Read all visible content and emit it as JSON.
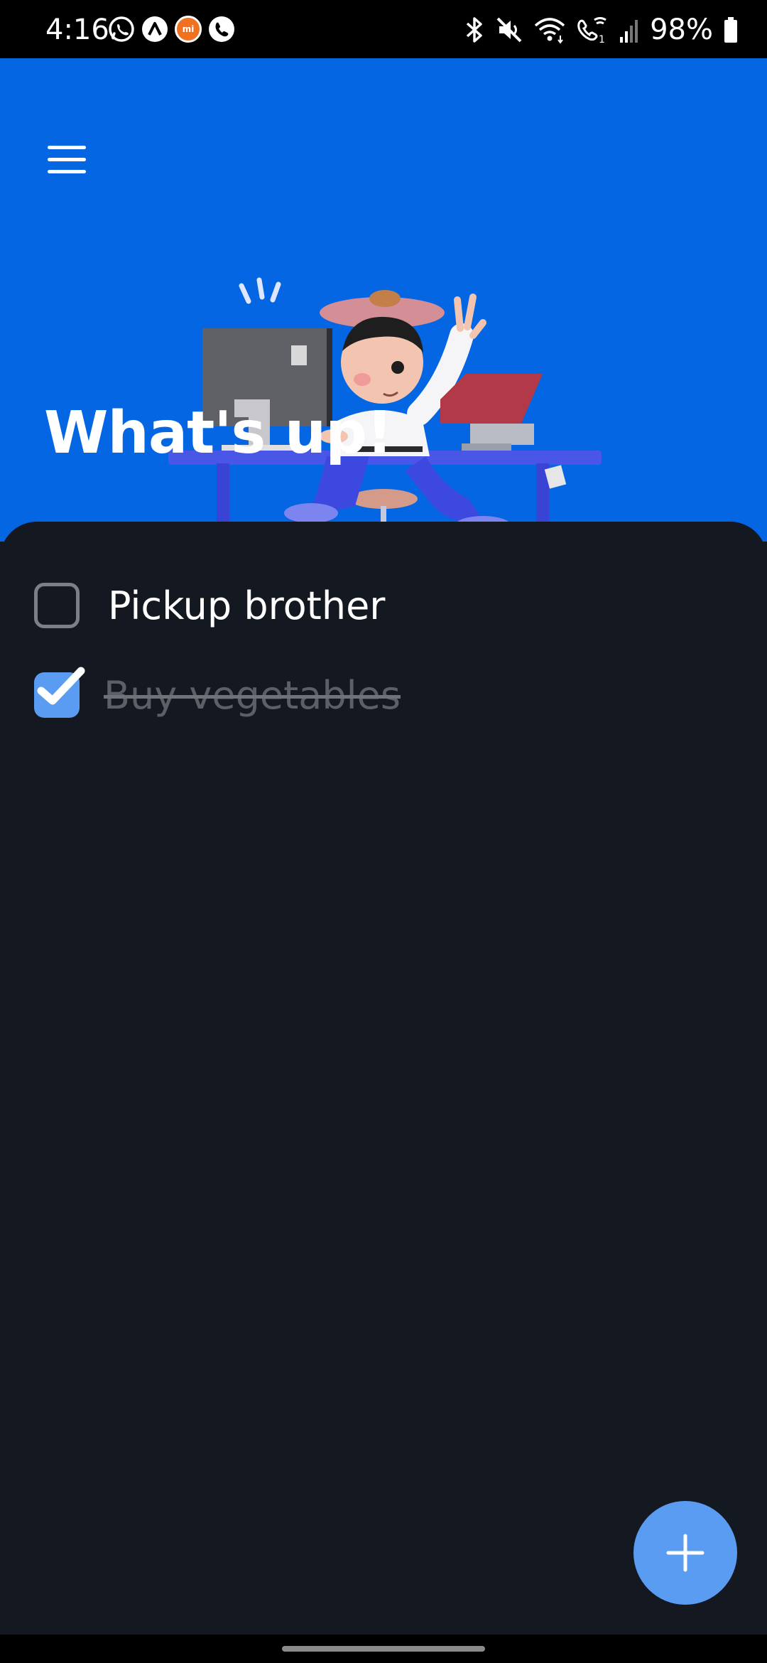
{
  "status_bar": {
    "time": "4:16",
    "left_icons": [
      "whatsapp-icon",
      "app-launcher-icon",
      "mi-icon",
      "phone-icon"
    ],
    "mi_label": "mi",
    "right_icons": [
      "bluetooth-icon",
      "mute-icon",
      "wifi-icon",
      "wifi-calling-icon",
      "signal-icon",
      "battery-icon"
    ],
    "battery": "98%"
  },
  "header": {
    "title": "What's up!",
    "menu_icon": "hamburger-menu-icon",
    "background_color": "#0466e3"
  },
  "tasks": [
    {
      "label": "Pickup brother",
      "checked": false
    },
    {
      "label": "Buy vegetables",
      "checked": true
    }
  ],
  "fab": {
    "icon": "plus-icon",
    "color": "#5b9cf3"
  },
  "colors": {
    "panel": "#141821",
    "accent": "#5b9cf3",
    "done_text": "#5b5f66"
  }
}
